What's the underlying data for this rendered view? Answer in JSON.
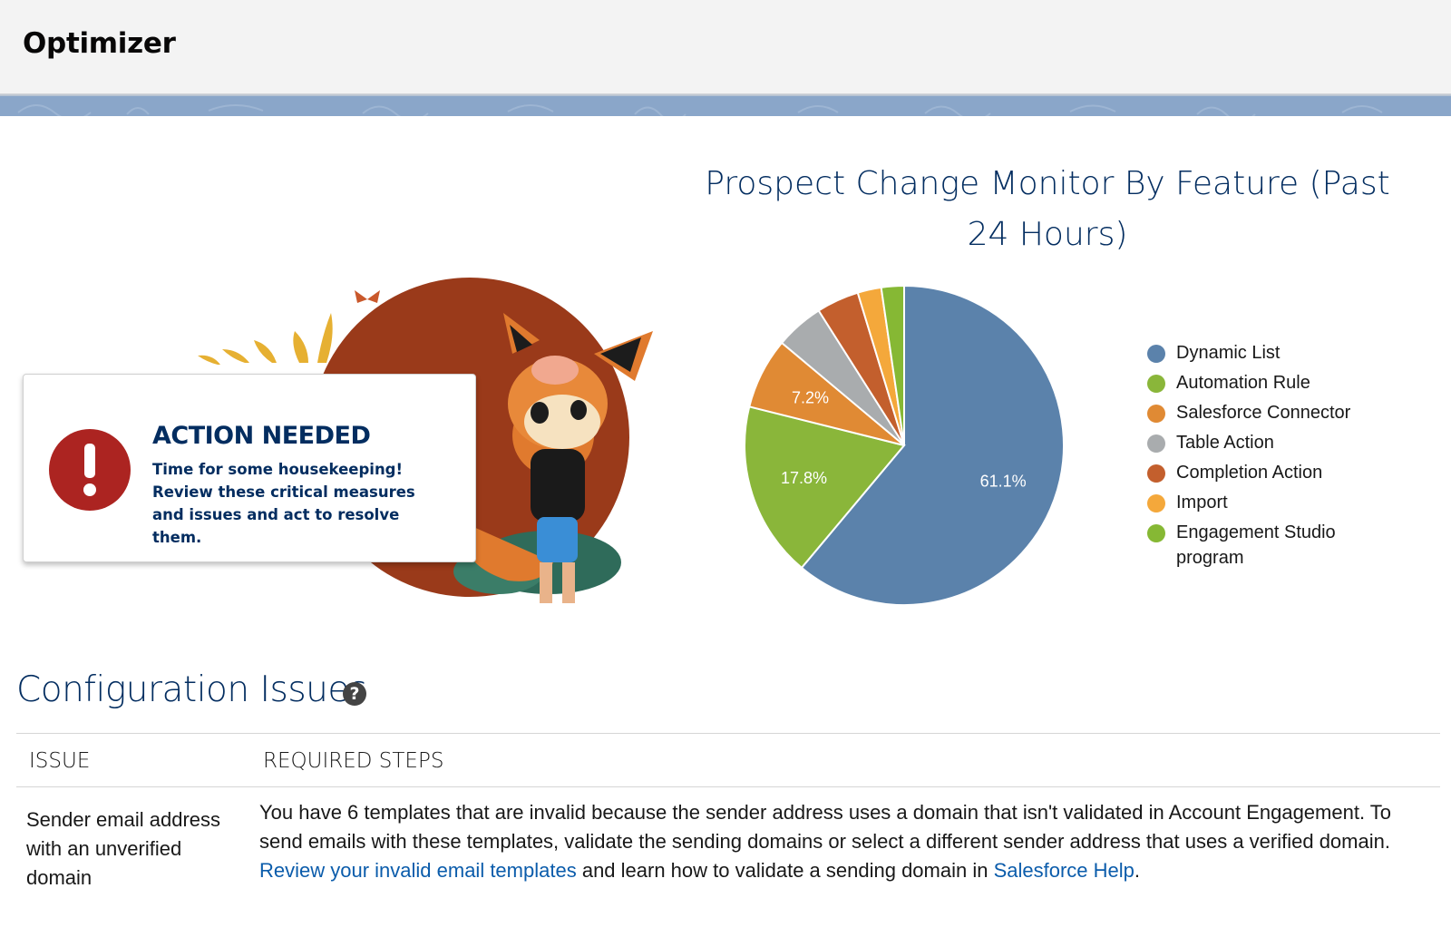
{
  "header": {
    "title": "Optimizer"
  },
  "action_card": {
    "heading": "ACTION NEEDED",
    "body": "Time for some housekeeping! Review these critical measures and issues and act to resolve them."
  },
  "chart": {
    "title": "Prospect Change Monitor By Feature (Past 24 Hours)"
  },
  "chart_data": {
    "type": "pie",
    "title": "Prospect Change Monitor By Feature (Past 24 Hours)",
    "categories": [
      "Dynamic List",
      "Automation Rule",
      "Salesforce Connector",
      "Table Action",
      "Completion Action",
      "Import",
      "Engagement Studio program"
    ],
    "values": [
      61.1,
      17.8,
      7.2,
      4.9,
      4.3,
      2.4,
      2.3
    ],
    "colors": [
      "#5b82ab",
      "#8ab63a",
      "#e08a34",
      "#a9acae",
      "#c35f2d",
      "#f4a83b",
      "#86b834"
    ],
    "data_labels": [
      "61.1%",
      "17.8%",
      "7.2%",
      "",
      "",
      "",
      ""
    ],
    "legend": "right"
  },
  "config": {
    "title": "Configuration Issues",
    "help_icon": "question-circle-icon",
    "columns": {
      "issue": "ISSUE",
      "steps": "REQUIRED STEPS"
    },
    "rows": [
      {
        "issue": "Sender email address with an unverified domain",
        "steps_text_1": "You have 6 templates that are invalid because the sender address uses a domain that isn't validated in Account Engagement. To send emails with these templates, validate the sending domains or select a different sender address that uses a verified domain.",
        "steps_link_1": "Review your invalid email templates",
        "steps_text_2": "and learn how to validate a sending domain in",
        "steps_link_2": "Salesforce Help",
        "steps_text_3": "."
      }
    ]
  }
}
